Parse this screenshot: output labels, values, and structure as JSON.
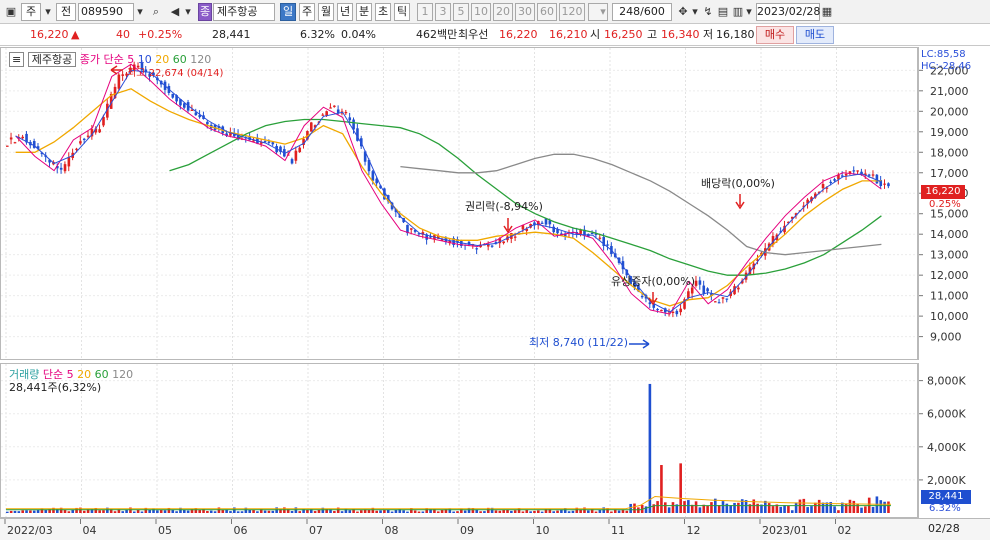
{
  "toolbar": {
    "market": "주",
    "prev": "전",
    "code": "089590",
    "name_tag": "종",
    "name": "제주항공",
    "periods": [
      "일",
      "주",
      "월",
      "년",
      "분",
      "초",
      "틱"
    ],
    "intervals": [
      "1",
      "3",
      "5",
      "10",
      "20",
      "30",
      "60",
      "120"
    ],
    "count": "248/600",
    "date": "2023/02/28"
  },
  "quote": {
    "price": "16,220",
    "change": "40",
    "change_pct": "+0.25%",
    "volume": "28,441",
    "vol_pct": "6.32%",
    "turnover": "0.04%",
    "amount": "462백만",
    "best_label": "최우선",
    "best_ask": "16,220",
    "best_bid": "16,210",
    "open_label": "시",
    "open": "16,250",
    "high_label": "고",
    "high": "16,340",
    "low_label": "저",
    "low": "16,180",
    "buy": "매수",
    "sell": "매도"
  },
  "legend": {
    "stock": "제주항공",
    "price_label": "종가",
    "ma_label": "단순",
    "ma": [
      "5",
      "10",
      "20",
      "60",
      "120"
    ],
    "vol_label": "거래량",
    "vol_value": "28,441주(6,32%)"
  },
  "annotations": {
    "high": "최고 22,674 (04/14)",
    "low": "최저 8,740 (11/22)",
    "rights": "권리락(-8,94%)",
    "dividend": "배당락(0,00%)",
    "paid_in": "유상증자(0,00%)",
    "lc": "LC:85,58",
    "hc": "HC:-28,46"
  },
  "axis": {
    "current_price": "16,220",
    "current_pct": "0.25%",
    "current_vol": "28,441",
    "current_vol_pct": "6.32%",
    "last_date": "02/28"
  },
  "colors": {
    "up": "#e02020",
    "down": "#1f4fd0",
    "ma5": "#e5007e",
    "ma10": "#2a4fd8",
    "ma20": "#f0a800",
    "ma60": "#2aa03a",
    "ma120": "#8a8a8a"
  },
  "chart_data": [
    {
      "type": "candlestick",
      "title": "제주항공 일봉",
      "x_months": [
        "2022/03",
        "04",
        "05",
        "06",
        "07",
        "08",
        "09",
        "10",
        "11",
        "12",
        "2023/01",
        "02"
      ],
      "y_ticks": [
        9000,
        10000,
        11000,
        12000,
        13000,
        14000,
        15000,
        16000,
        17000,
        18000,
        19000,
        20000,
        21000,
        22000
      ],
      "ylim": [
        8200,
        22700
      ],
      "series": [
        {
          "name": "종가",
          "values": [
            18800,
            17800,
            17100,
            18600,
            19200,
            21700,
            22300,
            21500,
            20600,
            19900,
            19200,
            18800,
            18600,
            18300,
            17600,
            19300,
            20200,
            19700,
            17100,
            15500,
            14200,
            13900,
            13700,
            13500,
            13400,
            13700,
            14300,
            14700,
            13900,
            14100,
            13800,
            12600,
            11100,
            10300,
            10100,
            11700,
            10600,
            11300,
            12600,
            13800,
            14900,
            15800,
            16600,
            17000,
            16900,
            16200
          ]
        },
        {
          "name": "20",
          "values": [
            18000,
            18000,
            18500,
            19200,
            20000,
            20800,
            21100,
            20500,
            20000,
            19600,
            19300,
            19000,
            18800,
            18600,
            18400,
            18700,
            19300,
            18900,
            17300,
            16000,
            15000,
            14300,
            13900,
            13700,
            13700,
            13900,
            14000,
            14100,
            14000,
            13800,
            13100,
            12300,
            11500,
            10800,
            10500,
            10800,
            10900,
            11500,
            12400,
            13200,
            14000,
            14900,
            15600,
            16200,
            16600,
            16600
          ]
        },
        {
          "name": "60",
          "values": [
            17100,
            17400,
            17900,
            18400,
            18900,
            19300,
            19500,
            19600,
            19600,
            19500,
            19400,
            19300,
            19200,
            18900,
            18400,
            17700,
            16900,
            16200,
            15500,
            15000,
            14600,
            14300,
            14100,
            13800,
            13500,
            13200,
            12800,
            12500,
            12200,
            12000,
            12000,
            12100,
            12300,
            12600,
            13000,
            13600,
            14200,
            14900
          ]
        },
        {
          "name": "120",
          "values": [
            17300,
            17200,
            17100,
            17000,
            17000,
            17100,
            17400,
            17700,
            17900,
            17900,
            17700,
            17400,
            17000,
            16600,
            16100,
            15500,
            14900,
            14200,
            13400,
            13100,
            13000,
            13100,
            13200,
            13300,
            13400,
            13500
          ]
        }
      ]
    },
    {
      "type": "bar",
      "title": "거래량",
      "y_ticks": [
        "2,000K",
        "4,000K",
        "6,000K",
        "8,000K"
      ],
      "ylim": [
        0,
        8400000
      ],
      "peak_volume": 7800000
    }
  ]
}
